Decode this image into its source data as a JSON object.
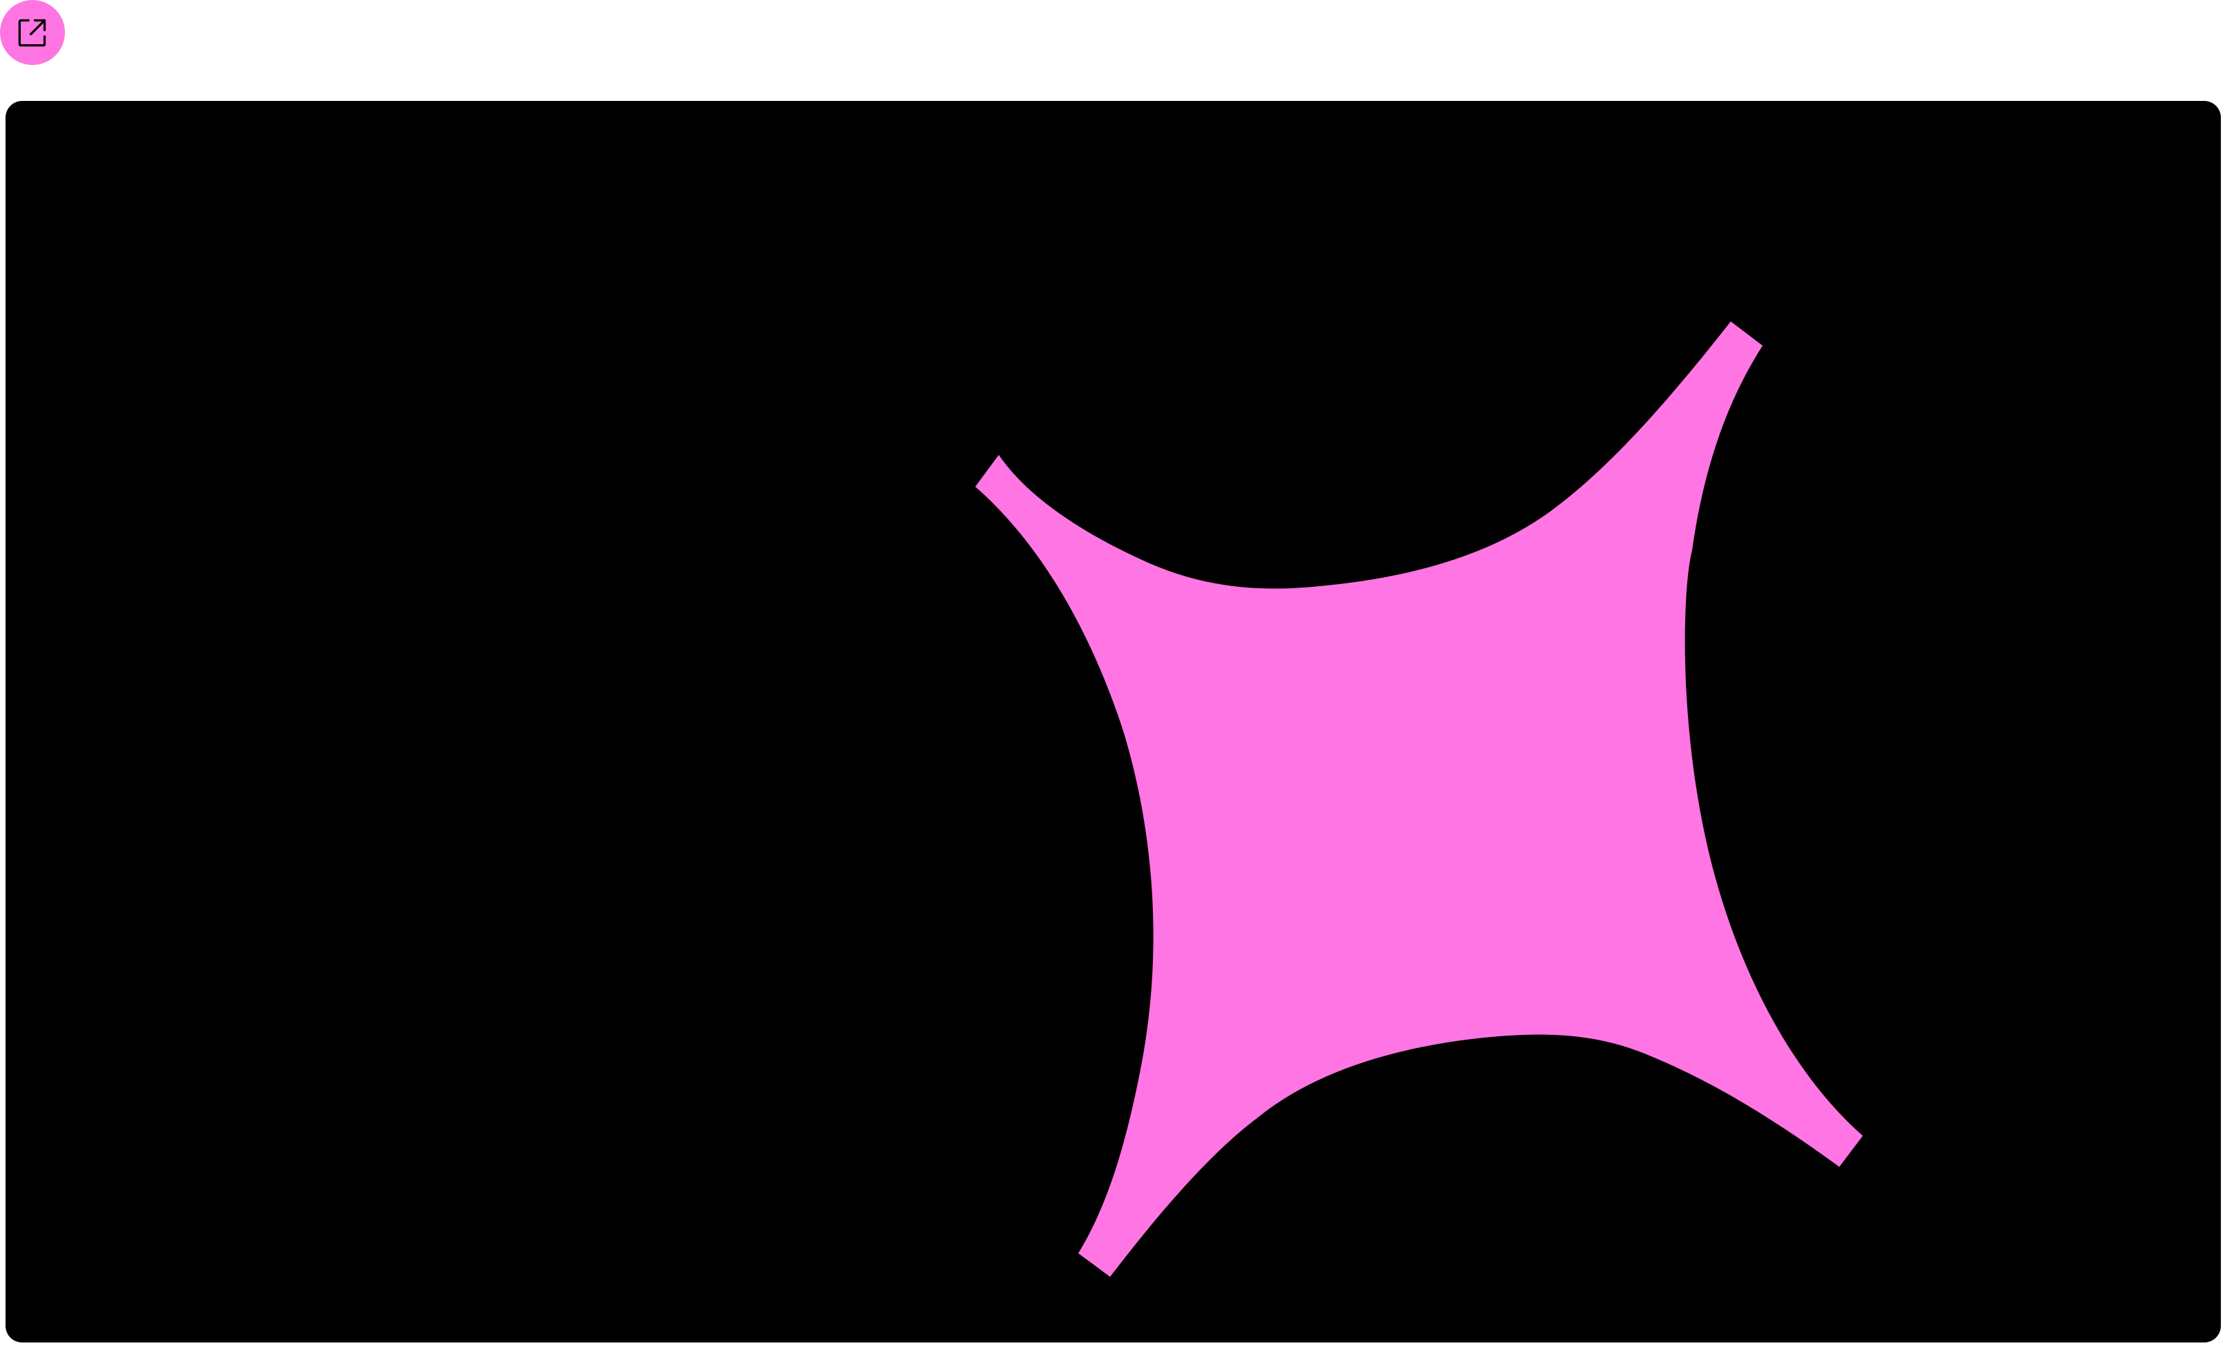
{
  "toolbar": {
    "open_button_icon": "open-in-new-window-icon",
    "open_button_color": "#ff75e3"
  },
  "canvas": {
    "background_color": "#000000",
    "shape": "four-point-sparkle-star",
    "shape_color": "#ff75e3"
  }
}
